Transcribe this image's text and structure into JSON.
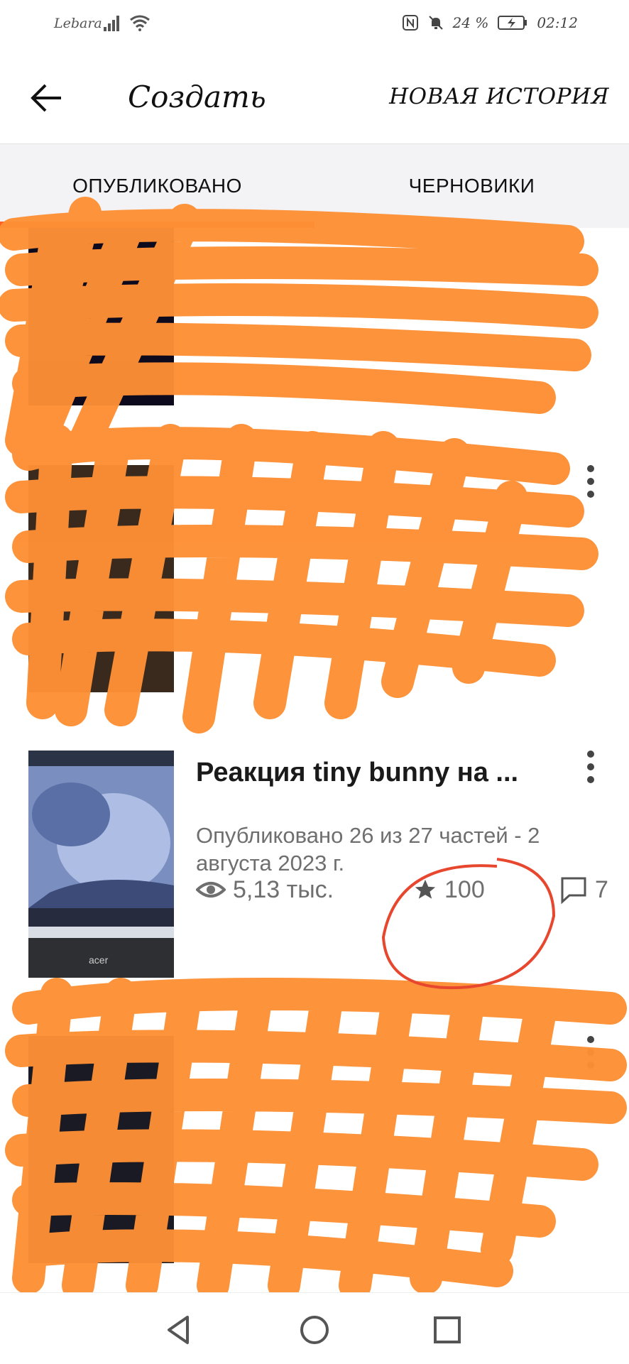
{
  "status_bar": {
    "carrier": "Lebara",
    "battery": "24 %",
    "time": "02:12"
  },
  "app_bar": {
    "title": "Создать",
    "new_story_label": "НОВАЯ ИСТОРИЯ"
  },
  "tabs": [
    {
      "label": "ОПУБЛИКОВАНО",
      "active": true
    },
    {
      "label": "ЧЕРНОВИКИ",
      "active": false
    }
  ],
  "stories": [
    {
      "title": "Реакция tiny bunny на ...",
      "meta": "Опубликовано 26 из 27 частей - 2 августа 2023 г.",
      "reads": "5,13 тыс.",
      "votes": "100",
      "comments": "7"
    }
  ],
  "colors": {
    "accent": "#ff6122",
    "scribble": "#fd8f35",
    "annotation_circle": "#e8472f"
  }
}
